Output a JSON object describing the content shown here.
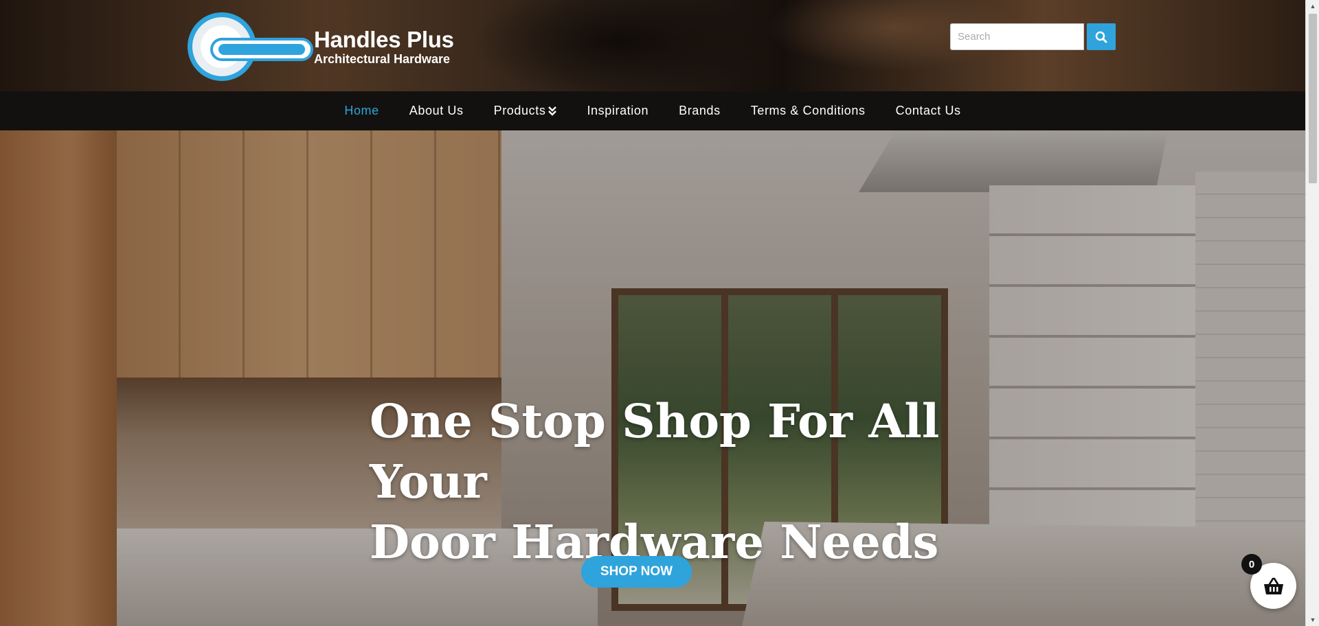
{
  "header": {
    "logo": {
      "name": "Handles Plus",
      "subtitle": "Architectural Hardware"
    },
    "search": {
      "placeholder": "Search",
      "button_icon": "search-icon"
    }
  },
  "nav": {
    "items": [
      {
        "label": "Home",
        "active": true
      },
      {
        "label": "About Us"
      },
      {
        "label": "Products",
        "icon": "chevron-double-down-icon"
      },
      {
        "label": "Inspiration"
      },
      {
        "label": "Brands"
      },
      {
        "label": "Terms & Conditions"
      },
      {
        "label": "Contact Us"
      }
    ]
  },
  "hero": {
    "title_line1": "One Stop Shop For All Your",
    "title_line2": "Door Hardware Needs",
    "cta_label": "SHOP NOW"
  },
  "cart": {
    "count": "0",
    "icon": "basket-icon"
  },
  "colors": {
    "accent": "#2ea3dc",
    "nav_bg": "#12100e",
    "text": "#ffffff"
  }
}
